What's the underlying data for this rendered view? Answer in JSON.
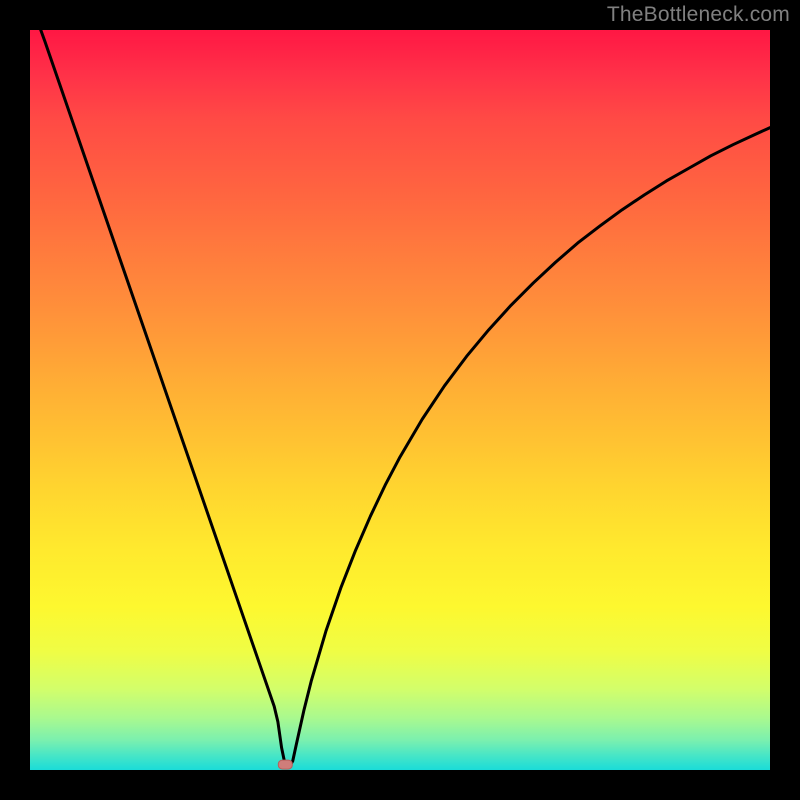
{
  "watermark": "TheBottleneck.com",
  "chart_data": {
    "type": "line",
    "title": "",
    "xlabel": "",
    "ylabel": "",
    "xlim": [
      0,
      100
    ],
    "ylim": [
      0,
      100
    ],
    "background": "rainbow-gradient (red top → green bottom)",
    "curve_description": "V-shaped black curve; steep linear descent from top-left to a minimum near x≈34, then a concave rise toward upper-right",
    "minimum_x": 34,
    "minimum_y": 0,
    "marker": {
      "x": 34.5,
      "y": 0.8,
      "color": "#d46a6a",
      "shape": "rounded-rect"
    },
    "series": [
      {
        "name": "bottleneck-curve",
        "x": [
          0,
          2,
          4,
          6,
          8,
          10,
          12,
          14,
          16,
          18,
          20,
          22,
          24,
          26,
          28,
          30,
          31,
          32,
          33,
          33.5,
          34,
          34.5,
          35,
          35.5,
          36,
          37,
          38,
          40,
          42,
          44,
          46,
          48,
          50,
          53,
          56,
          59,
          62,
          65,
          68,
          71,
          74,
          77,
          80,
          83,
          86,
          89,
          92,
          95,
          98,
          100
        ],
        "y": [
          104,
          98.5,
          92.7,
          86.9,
          81.1,
          75.3,
          69.5,
          63.7,
          57.9,
          52.1,
          46.3,
          40.5,
          34.7,
          28.9,
          23.1,
          17.3,
          14.4,
          11.5,
          8.6,
          6.5,
          3.0,
          0.6,
          0.4,
          1.2,
          3.5,
          8.0,
          12.0,
          18.8,
          24.6,
          29.7,
          34.3,
          38.5,
          42.3,
          47.4,
          51.9,
          55.9,
          59.5,
          62.8,
          65.8,
          68.6,
          71.2,
          73.5,
          75.7,
          77.7,
          79.6,
          81.3,
          83.0,
          84.5,
          85.9,
          86.8
        ]
      }
    ]
  }
}
